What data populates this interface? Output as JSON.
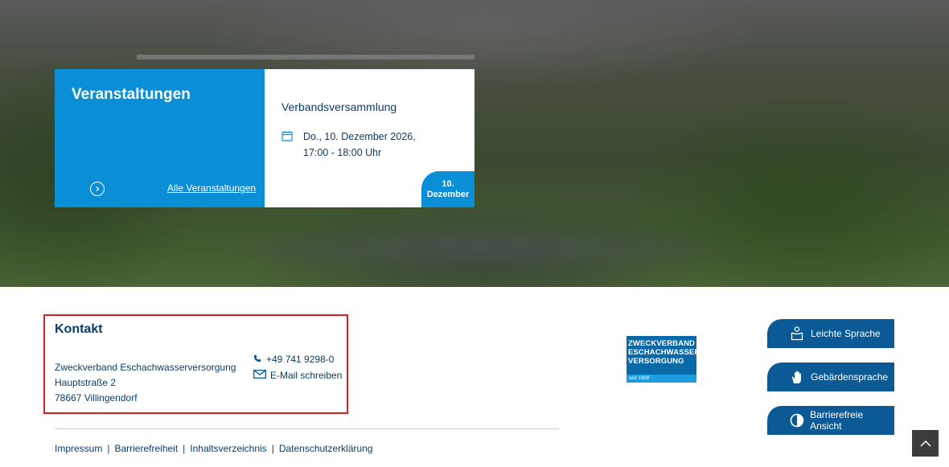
{
  "events": {
    "heading": "Veranstaltungen",
    "all_link": "Alle Veranstaltungen",
    "item": {
      "title": "Verbandsversammlung",
      "date_line1": "Do., 10. Dezember 2026,",
      "date_line2": "17:00 - 18:00 Uhr",
      "badge_day": "10.",
      "badge_month": "Dezember"
    }
  },
  "kontakt": {
    "title": "Kontakt",
    "org": "Zweckverband Eschachwasserversorgung",
    "street": "Hauptstraße 2",
    "city": "78667 Villingendorf",
    "phone": "+49 741 9298-0",
    "email_label": "E-Mail schreiben"
  },
  "logo": {
    "line1": "ZWECKVERBAND",
    "line2": "ESCHACHWASSER",
    "line3": "VERSORGUNG",
    "since": "seit 1908"
  },
  "accessibility": {
    "easy_language": "Leichte Sprache",
    "sign_language": "Gebärdensprache",
    "accessible_view": "Barrierefreie Ansicht"
  },
  "footer_links": {
    "impressum": "Impressum",
    "barrierefreiheit": "Barrierefreiheit",
    "inhaltsverzeichnis": "Inhaltsverzeichnis",
    "datenschutz": "Datenschutzerklärung",
    "separator": "|"
  },
  "colors": {
    "accent_blue": "#0a8ed6",
    "dark_blue": "#0b3d6b",
    "button_blue": "#0b5a96",
    "highlight_red": "#e01e1e"
  },
  "icons": {
    "arrow": "chevron-right-circle-icon",
    "calendar": "calendar-icon",
    "phone": "phone-icon",
    "email": "envelope-icon",
    "easy_language": "easy-language-icon",
    "sign_language": "sign-language-hand-icon",
    "contrast": "contrast-icon",
    "to_top": "chevron-up-icon"
  }
}
